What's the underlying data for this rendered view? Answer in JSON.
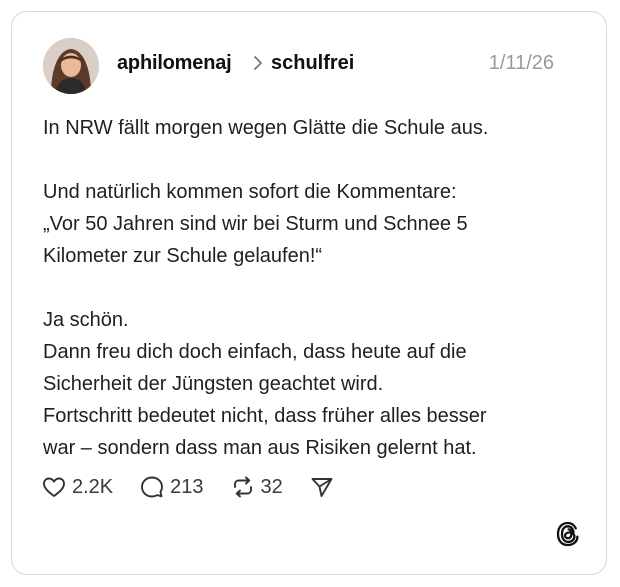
{
  "post": {
    "author": "aphilomenaj",
    "community": "schulfrei",
    "date": "1/11/26",
    "lines": [
      "In NRW fällt morgen wegen Glätte die Schule aus.",
      "",
      "Und natürlich kommen sofort die Kommentare:",
      "„Vor 50 Jahren sind wir bei Sturm und Schnee 5",
      "Kilometer zur Schule gelaufen!“",
      "",
      "Ja schön.",
      "Dann freu dich doch einfach, dass heute auf die",
      "Sicherheit der Jüngsten geachtet wird.",
      "Fortschritt bedeutet nicht, dass früher alles besser",
      "war – sondern dass man aus Risiken gelernt hat."
    ]
  },
  "actions": {
    "likes": "2.2K",
    "comments": "213",
    "reposts": "32"
  },
  "icons": [
    "avatar",
    "chevron-right-icon",
    "heart-icon",
    "comment-icon",
    "repost-icon",
    "share-icon",
    "threads-logo-icon"
  ]
}
